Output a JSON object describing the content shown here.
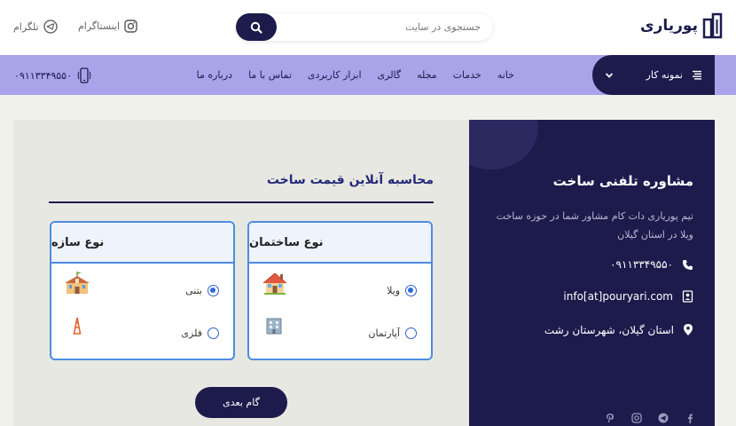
{
  "header": {
    "logo_text": "پوریاری",
    "search": {
      "placeholder": "جستجوی در سایت"
    },
    "social": [
      {
        "label": "اینستاگرام",
        "icon": "instagram-icon"
      },
      {
        "label": "تلگرام",
        "icon": "telegram-icon"
      }
    ]
  },
  "nav": {
    "dropdown_label": "نمونه کار",
    "links": [
      "خانه",
      "خدمات",
      "مجله",
      "گالری",
      "ابزار کاربردی",
      "تماس با ما",
      "درباره ما"
    ],
    "phone": "۰۹۱۱۳۳۴۹۵۵۰"
  },
  "calculator": {
    "title": "محاسبه آنلاین قیمت ساخت",
    "building_type": {
      "title": "نوع ساختمان",
      "options": [
        {
          "label": "ویلا",
          "selected": true,
          "icon": "house-icon"
        },
        {
          "label": "آپارتمان",
          "selected": false,
          "icon": "office-building-icon"
        }
      ]
    },
    "structure_type": {
      "title": "نوع سازه",
      "options": [
        {
          "label": "بتنی",
          "selected": true,
          "icon": "school-building-icon"
        },
        {
          "label": "فلزی",
          "selected": false,
          "icon": "tower-icon"
        }
      ]
    },
    "next_label": "گام بعدی"
  },
  "contact": {
    "title": "مشاوره تلفنی ساخت",
    "description": "تیم پوریاری دات کام مشاور شما در حوزه ساخت ویلا در استان گیلان",
    "phone": "۰۹۱۱۳۳۴۹۵۵۰",
    "email": "info[at]pouryari.com",
    "address": "استان گیلان، شهرستان رشت"
  },
  "colors": {
    "brand_dark": "#1d1b4c",
    "nav_bg": "#a9a4ea",
    "card_border": "#4c8ce0"
  }
}
